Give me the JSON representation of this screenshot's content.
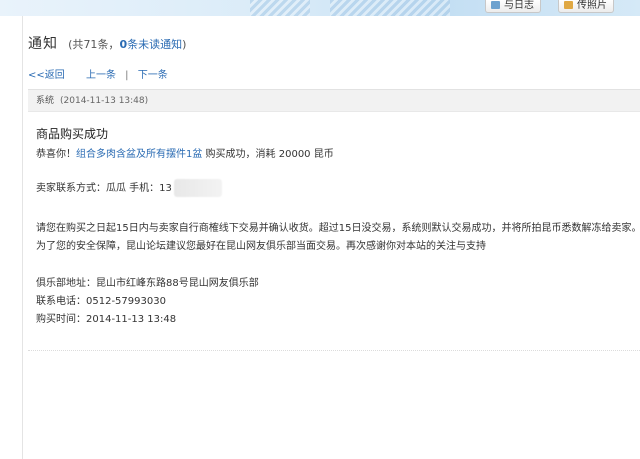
{
  "top_buttons": [
    {
      "label": "与日志"
    },
    {
      "label": "传照片"
    }
  ],
  "header": {
    "title": "通知",
    "count_prefix": "(共",
    "count": "71",
    "count_suffix": "条，",
    "unread_count": "0",
    "unread_label": "条未读通知",
    "close_paren": ")"
  },
  "nav": {
    "back": "<<返回",
    "prev": "上一条",
    "separator": "|",
    "next": "下一条"
  },
  "message": {
    "sender": "系统",
    "time": "(2014-11-13 13:48)",
    "subject": "商品购买成功",
    "congrats_prefix": "恭喜你！",
    "item_link": "组合多肉含盆及所有摆件1盆",
    "congrats_suffix": " 购买成功，消耗 20000 昆币",
    "seller_label": "卖家联系方式：瓜瓜 手机：13",
    "notice_line1": "请您在购买之日起15日内与卖家自行商榷线下交易并确认收货。超过15日没交易，系统则默认交易成功，并将所拍昆币悉数解冻给卖家。",
    "notice_line2": "为了您的安全保障，昆山论坛建议您最好在昆山网友俱乐部当面交易。再次感谢你对本站的关注与支持",
    "club_address": "俱乐部地址：昆山市红峰东路88号昆山网友俱乐部",
    "phone": "联系电话：0512-57993030",
    "purchase_time": "购买时间：2014-11-13 13:48"
  },
  "colors": {
    "link": "#2a6bb3",
    "header_bg": "#f2f2f2",
    "banner": "#d9ebf8"
  }
}
